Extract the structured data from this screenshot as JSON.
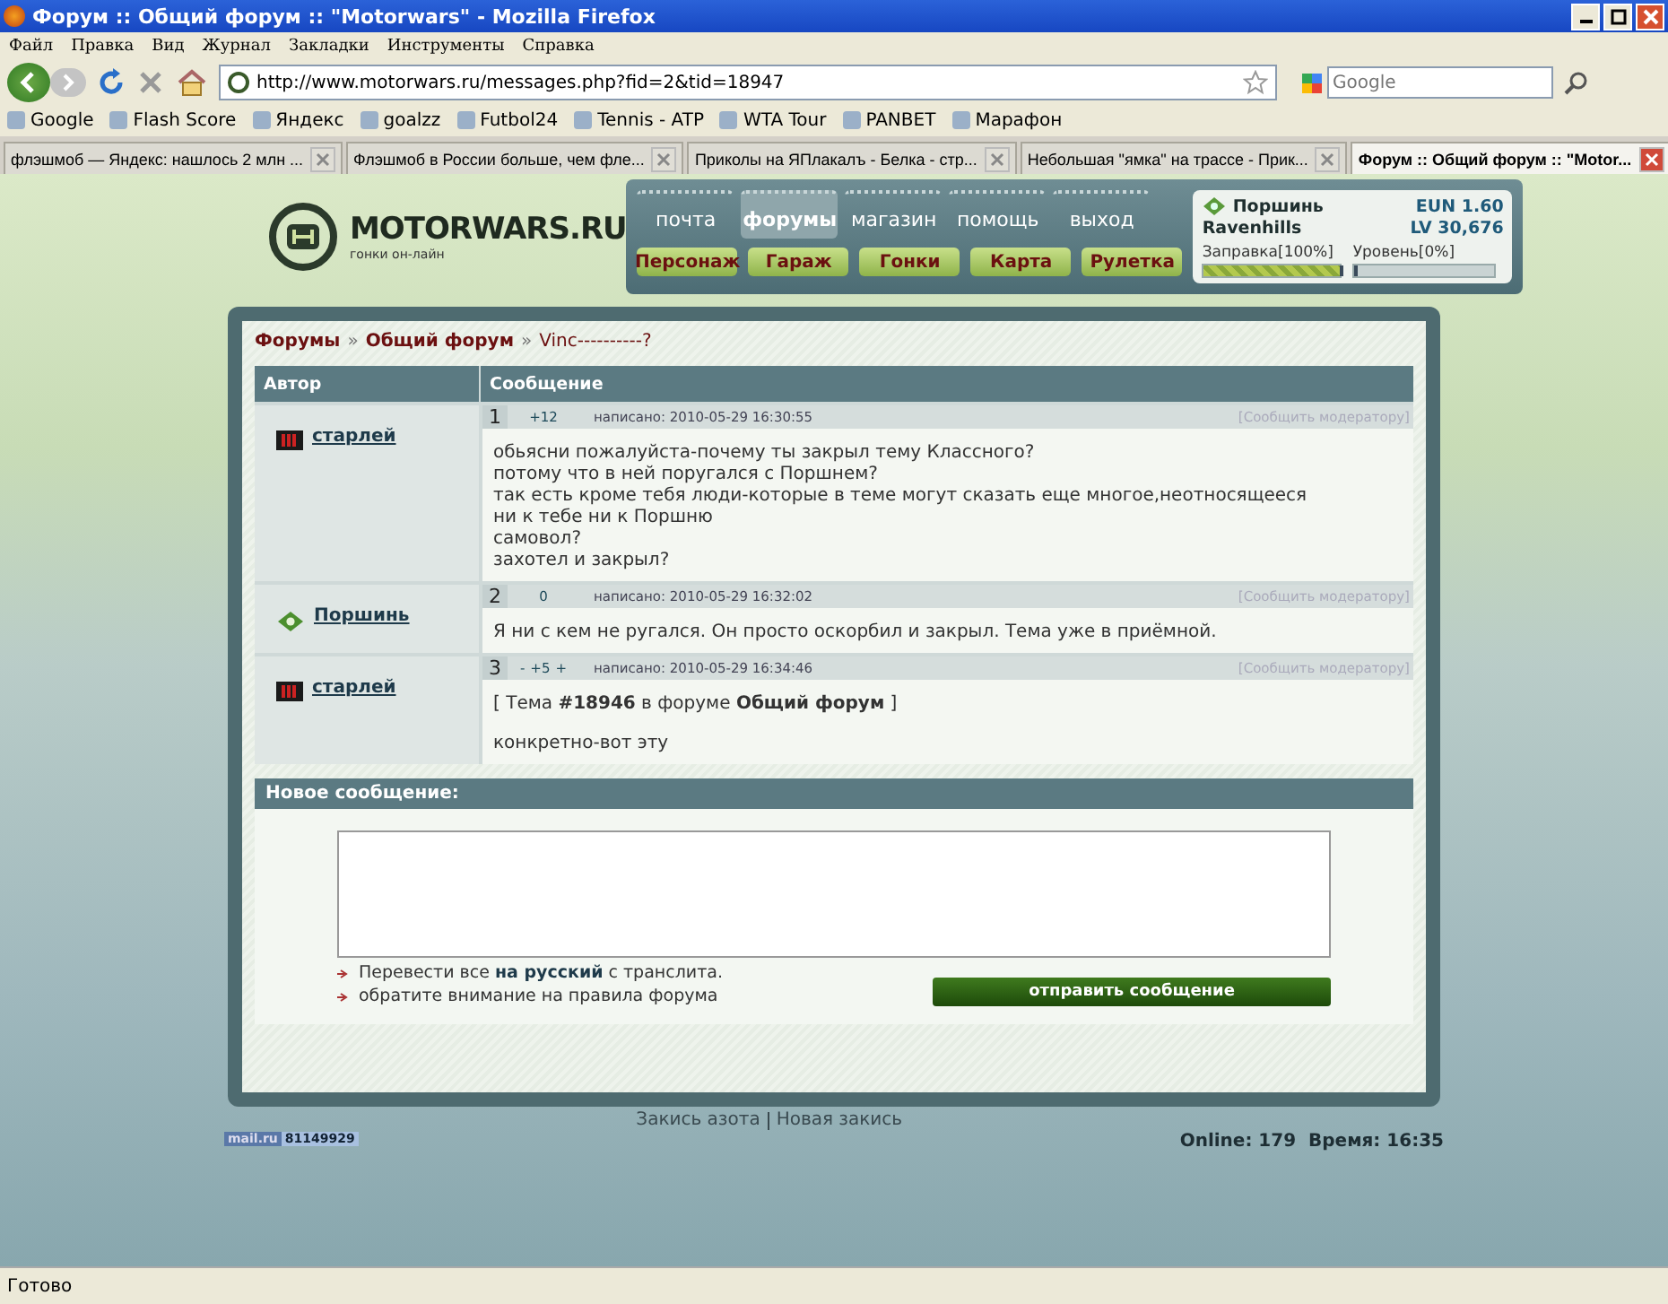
{
  "window": {
    "title": "Форум :: Общий форум :: \"Motorwars\" - Mozilla Firefox"
  },
  "menu": [
    "Файл",
    "Правка",
    "Вид",
    "Журнал",
    "Закладки",
    "Инструменты",
    "Справка"
  ],
  "address": {
    "url": "http://www.motorwars.ru/messages.php?fid=2&tid=18947"
  },
  "search": {
    "placeholder": "Google"
  },
  "bookmarks": [
    "Google",
    "Flash Score",
    "Яндекс",
    "goalzz",
    "Futbol24",
    "Tennis - ATP",
    "WTA Tour",
    "PANBET",
    "Марафон"
  ],
  "tabs": [
    {
      "label": "флэшмоб — Яндекс: нашлось 2 млн ...",
      "selected": false
    },
    {
      "label": "Флэшмоб в России больше, чем фле...",
      "selected": false
    },
    {
      "label": "Приколы на ЯПлакалъ - Белка - стр...",
      "selected": false
    },
    {
      "label": "Небольшая \"ямка\" на трассе - Прик...",
      "selected": false
    },
    {
      "label": "Форум :: Общий форум :: \"Motor...",
      "selected": true
    }
  ],
  "site": {
    "logo": "MOTORWARS.RU",
    "tagline": "гонки он-лайн",
    "nav": [
      {
        "label": "почта",
        "selected": false
      },
      {
        "label": "форумы",
        "selected": true
      },
      {
        "label": "магазин",
        "selected": false
      },
      {
        "label": "помощь",
        "selected": false
      },
      {
        "label": "выход",
        "selected": false
      }
    ],
    "subnav": [
      "Персонаж",
      "Гараж",
      "Гонки",
      "Карта",
      "Рулетка"
    ],
    "user": {
      "name": "Поршинь",
      "team": "Ravenhills",
      "eun_label": "EUN",
      "eun": "1.60",
      "lv_label": "LV",
      "lv": "30,676",
      "meters": [
        {
          "label": "Заправка[100%]",
          "level": 1
        },
        {
          "label": "Уровень[0%]",
          "level": 0
        }
      ]
    }
  },
  "breadcrumb": {
    "links": [
      "Форумы",
      "Общий форум"
    ],
    "separators": [
      "»",
      "»"
    ],
    "current": "Vinc----------?"
  },
  "table": {
    "columns": [
      "Автор",
      "Сообщение"
    ],
    "posts": [
      {
        "number": "1",
        "rating": "+12",
        "date": "написано: 2010-05-29 16:30:55",
        "report": "[Сообщить модератору]",
        "author": "старлей",
        "kind": "bars",
        "lines": [
          "обьясни пожалуйста-почему ты закрыл тему Классного?",
          "потому что в ней поругался с Поршнем?",
          "так есть кроме тебя люди-которые в теме могут сказать еще многое,неотносящееся",
          "ни к тебе ни к Поршню",
          "самовол?",
          "захотел и закрыл?"
        ]
      },
      {
        "number": "2",
        "rating": "0",
        "date": "написано: 2010-05-29 16:32:02",
        "report": "[Сообщить модератору]",
        "author": "Поршинь",
        "kind": "emblem",
        "lines": [
          "Я ни с кем не ругался. Он просто оскорбил и закрыл. Тема уже в приёмной."
        ]
      },
      {
        "number": "3",
        "vote_down": "-",
        "rating": "+5",
        "vote_up": "+",
        "date": "написано: 2010-05-29 16:34:46",
        "report": "[Сообщить модератору]",
        "author": "старлей",
        "kind": "bars",
        "quote": "[ Тема **#18946** в форуме **Общий форум** ]",
        "lines": [
          "конкретно-вот эту"
        ]
      }
    ]
  },
  "new_message": {
    "title": "Новое сообщение:",
    "hints": [
      "Перевести все **на русский** с транслита.",
      "обратите внимание на правила форума"
    ],
    "submit": "отправить сообщение"
  },
  "footer": {
    "links": [
      "Закись азота",
      "Новая закись"
    ],
    "counter_logo": "mail.ru",
    "counter": "81149929",
    "online": "Online: 179  Время: 16:35"
  },
  "status_bar": "Готово"
}
